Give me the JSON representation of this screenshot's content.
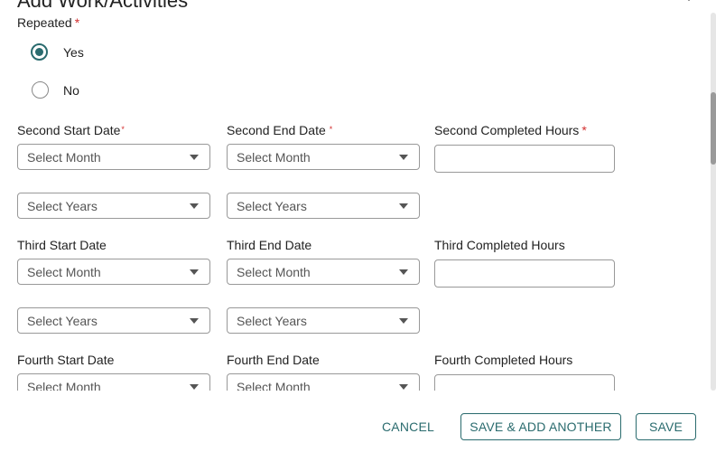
{
  "dialog": {
    "title": "Add Work/Activities",
    "close_icon": "close-icon"
  },
  "repeated": {
    "label": "Repeated",
    "required_mark": "*",
    "options": [
      {
        "label": "Yes",
        "checked": true
      },
      {
        "label": "No",
        "checked": false
      }
    ]
  },
  "rows": [
    {
      "start_label": "Second Start Date",
      "start_required": true,
      "end_label": "Second End Date",
      "end_required": true,
      "hours_label": "Second Completed Hours",
      "hours_required": true,
      "start_month": "Select Month",
      "start_years": "Select Years",
      "end_month": "Select Month",
      "end_years": "Select Years",
      "hours_value": ""
    },
    {
      "start_label": "Third Start Date",
      "end_label": "Third End Date",
      "hours_label": "Third Completed Hours",
      "start_month": "Select Month",
      "start_years": "Select Years",
      "end_month": "Select Month",
      "end_years": "Select Years",
      "hours_value": ""
    },
    {
      "start_label": "Fourth Start Date",
      "end_label": "Fourth End Date",
      "hours_label": "Fourth Completed Hours",
      "start_month": "Select Month",
      "end_month": "Select Month",
      "hours_value": ""
    }
  ],
  "required_mark": "*",
  "footer": {
    "cancel": "CANCEL",
    "save_add_another": "SAVE & ADD ANOTHER",
    "save": "SAVE"
  },
  "colors": {
    "accent": "#2a6b6e",
    "required": "#d32f2f"
  }
}
